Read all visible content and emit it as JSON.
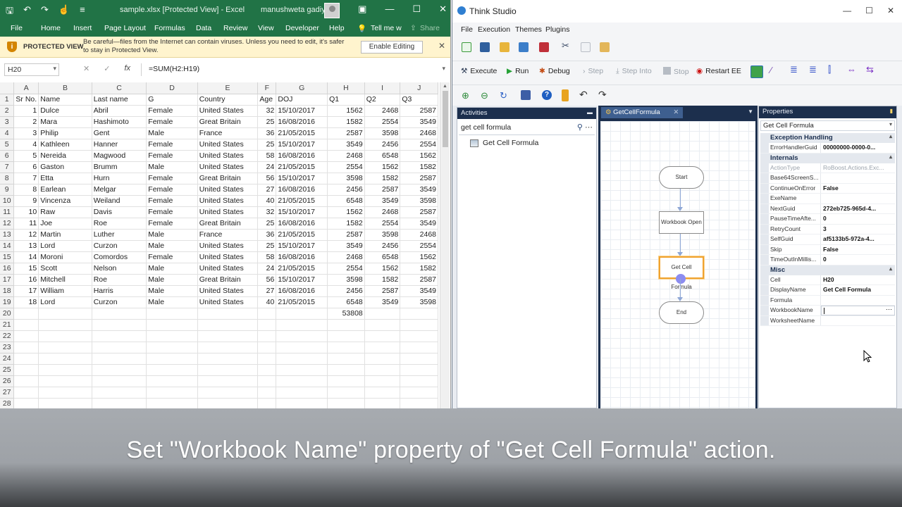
{
  "excel": {
    "filename": "sample.xlsx  [Protected View]  -  Excel",
    "user": "manushweta gadiya",
    "menu": [
      "File",
      "Home",
      "Insert",
      "Page Layout",
      "Formulas",
      "Data",
      "Review",
      "View",
      "Developer",
      "Help",
      "Tell me w",
      "Share"
    ],
    "protected": {
      "label": "PROTECTED VIEW",
      "message": "Be careful—files from the Internet can contain viruses. Unless you need to edit, it's safer to stay in Protected View.",
      "button": "Enable Editing"
    },
    "namebox": "H20",
    "formula": "=SUM(H2:H19)",
    "columns": [
      "A",
      "B",
      "C",
      "D",
      "E",
      "F",
      "G",
      "H",
      "I",
      "J"
    ],
    "headers": [
      "Sr No.",
      "Name",
      "Last name",
      "G",
      "Country",
      "Age",
      "DOJ",
      "Q1",
      "Q2",
      "Q3"
    ],
    "rows": [
      [
        "1",
        "Dulce",
        "Abril",
        "Female",
        "United States",
        "32",
        "15/10/2017",
        "1562",
        "2468",
        "2587"
      ],
      [
        "2",
        "Mara",
        "Hashimoto",
        "Female",
        "Great Britain",
        "25",
        "16/08/2016",
        "1582",
        "2554",
        "3549"
      ],
      [
        "3",
        "Philip",
        "Gent",
        "Male",
        "France",
        "36",
        "21/05/2015",
        "2587",
        "3598",
        "2468"
      ],
      [
        "4",
        "Kathleen",
        "Hanner",
        "Female",
        "United States",
        "25",
        "15/10/2017",
        "3549",
        "2456",
        "2554"
      ],
      [
        "5",
        "Nereida",
        "Magwood",
        "Female",
        "United States",
        "58",
        "16/08/2016",
        "2468",
        "6548",
        "1562"
      ],
      [
        "6",
        "Gaston",
        "Brumm",
        "Male",
        "United States",
        "24",
        "21/05/2015",
        "2554",
        "1562",
        "1582"
      ],
      [
        "7",
        "Etta",
        "Hurn",
        "Female",
        "Great Britain",
        "56",
        "15/10/2017",
        "3598",
        "1582",
        "2587"
      ],
      [
        "8",
        "Earlean",
        "Melgar",
        "Female",
        "United States",
        "27",
        "16/08/2016",
        "2456",
        "2587",
        "3549"
      ],
      [
        "9",
        "Vincenza",
        "Weiland",
        "Female",
        "United States",
        "40",
        "21/05/2015",
        "6548",
        "3549",
        "3598"
      ],
      [
        "10",
        "Raw",
        "Davis",
        "Female",
        "United States",
        "32",
        "15/10/2017",
        "1562",
        "2468",
        "2587"
      ],
      [
        "11",
        "Joe",
        "Roe",
        "Female",
        "Great Britain",
        "25",
        "16/08/2016",
        "1582",
        "2554",
        "3549"
      ],
      [
        "12",
        "Martin",
        "Luther",
        "Male",
        "France",
        "36",
        "21/05/2015",
        "2587",
        "3598",
        "2468"
      ],
      [
        "13",
        "Lord",
        "Curzon",
        "Male",
        "United States",
        "25",
        "15/10/2017",
        "3549",
        "2456",
        "2554"
      ],
      [
        "14",
        "Moroni",
        "Comordos",
        "Female",
        "United States",
        "58",
        "16/08/2016",
        "2468",
        "6548",
        "1562"
      ],
      [
        "15",
        "Scott",
        "Nelson",
        "Male",
        "United States",
        "24",
        "21/05/2015",
        "2554",
        "1562",
        "1582"
      ],
      [
        "16",
        "Mitchell",
        "Roe",
        "Male",
        "Great Britain",
        "56",
        "15/10/2017",
        "3598",
        "1582",
        "2587"
      ],
      [
        "17",
        "William",
        "Harris",
        "Male",
        "United States",
        "27",
        "16/08/2016",
        "2456",
        "2587",
        "3549"
      ],
      [
        "18",
        "Lord",
        "Curzon",
        "Male",
        "United States",
        "40",
        "21/05/2015",
        "6548",
        "3549",
        "3598"
      ],
      [
        "",
        "",
        "",
        "",
        "",
        "",
        "",
        "53808",
        "",
        ""
      ]
    ],
    "empty_rows": [
      "21",
      "22",
      "23",
      "24",
      "25",
      "26",
      "27",
      "28"
    ]
  },
  "studio": {
    "title": "Think Studio",
    "menu": [
      "File",
      "Execution",
      "Themes",
      "Plugins"
    ],
    "toolbar2": {
      "execute": "Execute",
      "run": "Run",
      "debug": "Debug",
      "step": "Step",
      "step_into": "Step Into",
      "stop": "Stop",
      "restart": "Restart EE"
    },
    "activities": {
      "title": "Activities",
      "search_value": "get cell formula",
      "items": [
        "Get Cell Formula"
      ]
    },
    "designer": {
      "tab": "GetCellFormula",
      "nodes": [
        "Start",
        "Workbook Open",
        "Get Cell Formula",
        "End"
      ]
    },
    "properties": {
      "title": "Properties",
      "object": "Get Cell Formula",
      "categories": [
        {
          "name": "Exception Handling",
          "rows": [
            {
              "key": "ErrorHandlerGuid",
              "value": "00000000-0000-0..."
            }
          ]
        },
        {
          "name": "Internals",
          "rows": [
            {
              "key": "ActionType",
              "value": "RoBoost.Actions.Exc...",
              "gray": true
            },
            {
              "key": "Base64ScreenS...",
              "value": ""
            },
            {
              "key": "ContinueOnError",
              "value": "False"
            },
            {
              "key": "ExeName",
              "value": ""
            },
            {
              "key": "NextGuid",
              "value": "272eb725-965d-4..."
            },
            {
              "key": "PauseTimeAfte...",
              "value": "0"
            },
            {
              "key": "RetryCount",
              "value": "3"
            },
            {
              "key": "SelfGuid",
              "value": "af5133b5-972a-4..."
            },
            {
              "key": "Skip",
              "value": "False"
            },
            {
              "key": "TimeOutInMillis...",
              "value": "0"
            }
          ]
        },
        {
          "name": "Misc",
          "rows": [
            {
              "key": "Cell",
              "value": "H20"
            },
            {
              "key": "DisplayName",
              "value": "Get Cell Formula"
            },
            {
              "key": "Formula",
              "value": ""
            },
            {
              "key": "WorkbookName",
              "value": "",
              "editing": true
            },
            {
              "key": "WorksheetName",
              "value": ""
            }
          ]
        }
      ]
    }
  },
  "caption": "Set \"Workbook Name\" property of \"Get Cell Formula\" action."
}
